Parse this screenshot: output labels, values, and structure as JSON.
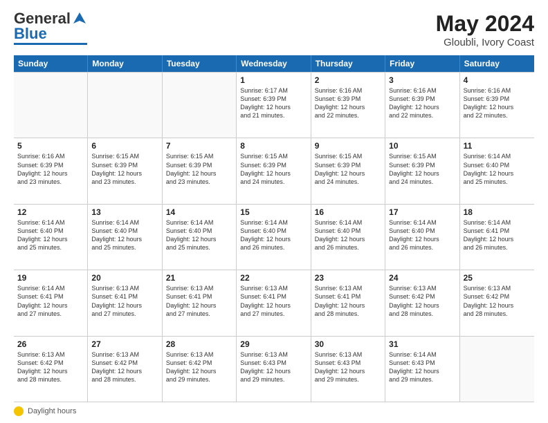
{
  "header": {
    "logo_text": "General Blue",
    "title": "May 2024",
    "location": "Gloubli, Ivory Coast"
  },
  "footer": {
    "label": "Daylight hours"
  },
  "calendar": {
    "weekdays": [
      "Sunday",
      "Monday",
      "Tuesday",
      "Wednesday",
      "Thursday",
      "Friday",
      "Saturday"
    ],
    "rows": [
      [
        {
          "day": "",
          "info": ""
        },
        {
          "day": "",
          "info": ""
        },
        {
          "day": "",
          "info": ""
        },
        {
          "day": "1",
          "info": "Sunrise: 6:17 AM\nSunset: 6:39 PM\nDaylight: 12 hours\nand 21 minutes."
        },
        {
          "day": "2",
          "info": "Sunrise: 6:16 AM\nSunset: 6:39 PM\nDaylight: 12 hours\nand 22 minutes."
        },
        {
          "day": "3",
          "info": "Sunrise: 6:16 AM\nSunset: 6:39 PM\nDaylight: 12 hours\nand 22 minutes."
        },
        {
          "day": "4",
          "info": "Sunrise: 6:16 AM\nSunset: 6:39 PM\nDaylight: 12 hours\nand 22 minutes."
        }
      ],
      [
        {
          "day": "5",
          "info": "Sunrise: 6:16 AM\nSunset: 6:39 PM\nDaylight: 12 hours\nand 23 minutes."
        },
        {
          "day": "6",
          "info": "Sunrise: 6:15 AM\nSunset: 6:39 PM\nDaylight: 12 hours\nand 23 minutes."
        },
        {
          "day": "7",
          "info": "Sunrise: 6:15 AM\nSunset: 6:39 PM\nDaylight: 12 hours\nand 23 minutes."
        },
        {
          "day": "8",
          "info": "Sunrise: 6:15 AM\nSunset: 6:39 PM\nDaylight: 12 hours\nand 24 minutes."
        },
        {
          "day": "9",
          "info": "Sunrise: 6:15 AM\nSunset: 6:39 PM\nDaylight: 12 hours\nand 24 minutes."
        },
        {
          "day": "10",
          "info": "Sunrise: 6:15 AM\nSunset: 6:39 PM\nDaylight: 12 hours\nand 24 minutes."
        },
        {
          "day": "11",
          "info": "Sunrise: 6:14 AM\nSunset: 6:40 PM\nDaylight: 12 hours\nand 25 minutes."
        }
      ],
      [
        {
          "day": "12",
          "info": "Sunrise: 6:14 AM\nSunset: 6:40 PM\nDaylight: 12 hours\nand 25 minutes."
        },
        {
          "day": "13",
          "info": "Sunrise: 6:14 AM\nSunset: 6:40 PM\nDaylight: 12 hours\nand 25 minutes."
        },
        {
          "day": "14",
          "info": "Sunrise: 6:14 AM\nSunset: 6:40 PM\nDaylight: 12 hours\nand 25 minutes."
        },
        {
          "day": "15",
          "info": "Sunrise: 6:14 AM\nSunset: 6:40 PM\nDaylight: 12 hours\nand 26 minutes."
        },
        {
          "day": "16",
          "info": "Sunrise: 6:14 AM\nSunset: 6:40 PM\nDaylight: 12 hours\nand 26 minutes."
        },
        {
          "day": "17",
          "info": "Sunrise: 6:14 AM\nSunset: 6:40 PM\nDaylight: 12 hours\nand 26 minutes."
        },
        {
          "day": "18",
          "info": "Sunrise: 6:14 AM\nSunset: 6:41 PM\nDaylight: 12 hours\nand 26 minutes."
        }
      ],
      [
        {
          "day": "19",
          "info": "Sunrise: 6:14 AM\nSunset: 6:41 PM\nDaylight: 12 hours\nand 27 minutes."
        },
        {
          "day": "20",
          "info": "Sunrise: 6:13 AM\nSunset: 6:41 PM\nDaylight: 12 hours\nand 27 minutes."
        },
        {
          "day": "21",
          "info": "Sunrise: 6:13 AM\nSunset: 6:41 PM\nDaylight: 12 hours\nand 27 minutes."
        },
        {
          "day": "22",
          "info": "Sunrise: 6:13 AM\nSunset: 6:41 PM\nDaylight: 12 hours\nand 27 minutes."
        },
        {
          "day": "23",
          "info": "Sunrise: 6:13 AM\nSunset: 6:41 PM\nDaylight: 12 hours\nand 28 minutes."
        },
        {
          "day": "24",
          "info": "Sunrise: 6:13 AM\nSunset: 6:42 PM\nDaylight: 12 hours\nand 28 minutes."
        },
        {
          "day": "25",
          "info": "Sunrise: 6:13 AM\nSunset: 6:42 PM\nDaylight: 12 hours\nand 28 minutes."
        }
      ],
      [
        {
          "day": "26",
          "info": "Sunrise: 6:13 AM\nSunset: 6:42 PM\nDaylight: 12 hours\nand 28 minutes."
        },
        {
          "day": "27",
          "info": "Sunrise: 6:13 AM\nSunset: 6:42 PM\nDaylight: 12 hours\nand 28 minutes."
        },
        {
          "day": "28",
          "info": "Sunrise: 6:13 AM\nSunset: 6:42 PM\nDaylight: 12 hours\nand 29 minutes."
        },
        {
          "day": "29",
          "info": "Sunrise: 6:13 AM\nSunset: 6:43 PM\nDaylight: 12 hours\nand 29 minutes."
        },
        {
          "day": "30",
          "info": "Sunrise: 6:13 AM\nSunset: 6:43 PM\nDaylight: 12 hours\nand 29 minutes."
        },
        {
          "day": "31",
          "info": "Sunrise: 6:14 AM\nSunset: 6:43 PM\nDaylight: 12 hours\nand 29 minutes."
        },
        {
          "day": "",
          "info": ""
        }
      ]
    ]
  }
}
